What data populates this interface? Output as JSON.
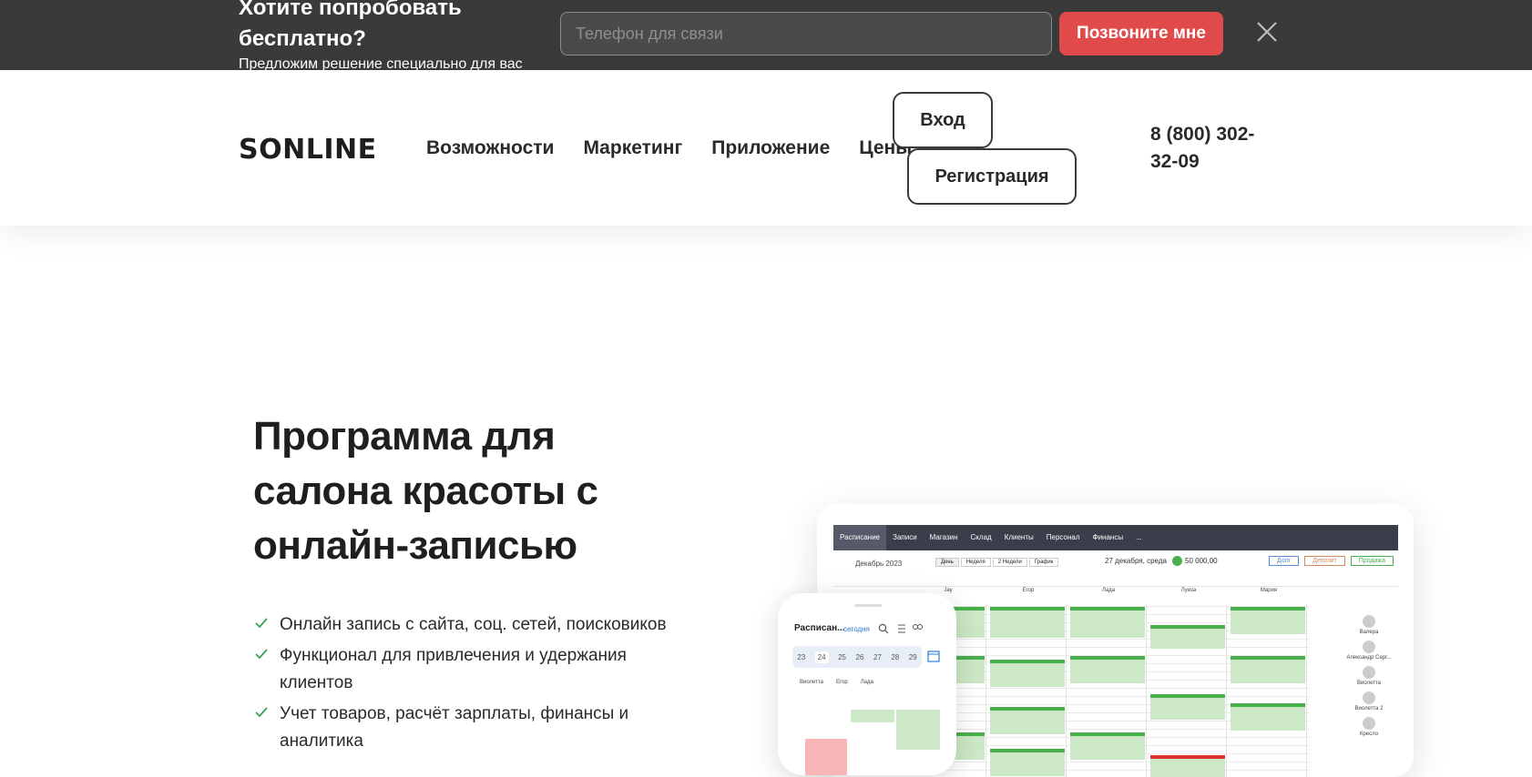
{
  "promo": {
    "title": "Хотите попробовать бесплатно?",
    "subtitle": "Предложим решение специально для вас",
    "phone_placeholder": "Телефон для связи",
    "call_button": "Позвоните мне"
  },
  "header": {
    "logo": "SONLINE",
    "nav": [
      "Возможности",
      "Маркетинг",
      "Приложение",
      "Цены"
    ],
    "login": "Вход",
    "register": "Регистрация",
    "phone": "8 (800) 302-32-09"
  },
  "hero": {
    "title": "Программа для салона красоты с онлайн-записью",
    "features": [
      "Онлайн запись с сайта, соц. сетей, поисковиков",
      "Функционал для привлечения и удержания клиентов",
      "Учет товаров, расчёт зарплаты, финансы и аналитика"
    ]
  },
  "mockup": {
    "tabs": [
      "Расписание",
      "Записи",
      "Магазин",
      "Склад",
      "Клиенты",
      "Персонал",
      "Финансы",
      "..."
    ],
    "month": "Декабрь 2023",
    "date": "27 декабря, среда",
    "balance": "50 000,00",
    "view_buttons": [
      "День",
      "Неделя",
      "2 Недели",
      "График"
    ],
    "action_buttons": [
      "Долг",
      "Депозит",
      "Продажа"
    ],
    "staff": [
      "Jay",
      "Егор",
      "Лада",
      "Луиза",
      "Мария"
    ],
    "right_staff": [
      "Валера",
      "Александр Серг...",
      "Виолетта",
      "Виолетта 2",
      "Кресло"
    ],
    "phone_title": "Расписан...",
    "phone_today": "сегодня",
    "phone_days": [
      "23",
      "24",
      "25",
      "26",
      "27",
      "28",
      "29"
    ],
    "phone_staff": [
      "Виолетта",
      "Егор",
      "Лада"
    ]
  },
  "colors": {
    "promo_bg": "#3a3a3a",
    "accent_red": "#e04a4a",
    "check_green": "#3aa04a"
  }
}
